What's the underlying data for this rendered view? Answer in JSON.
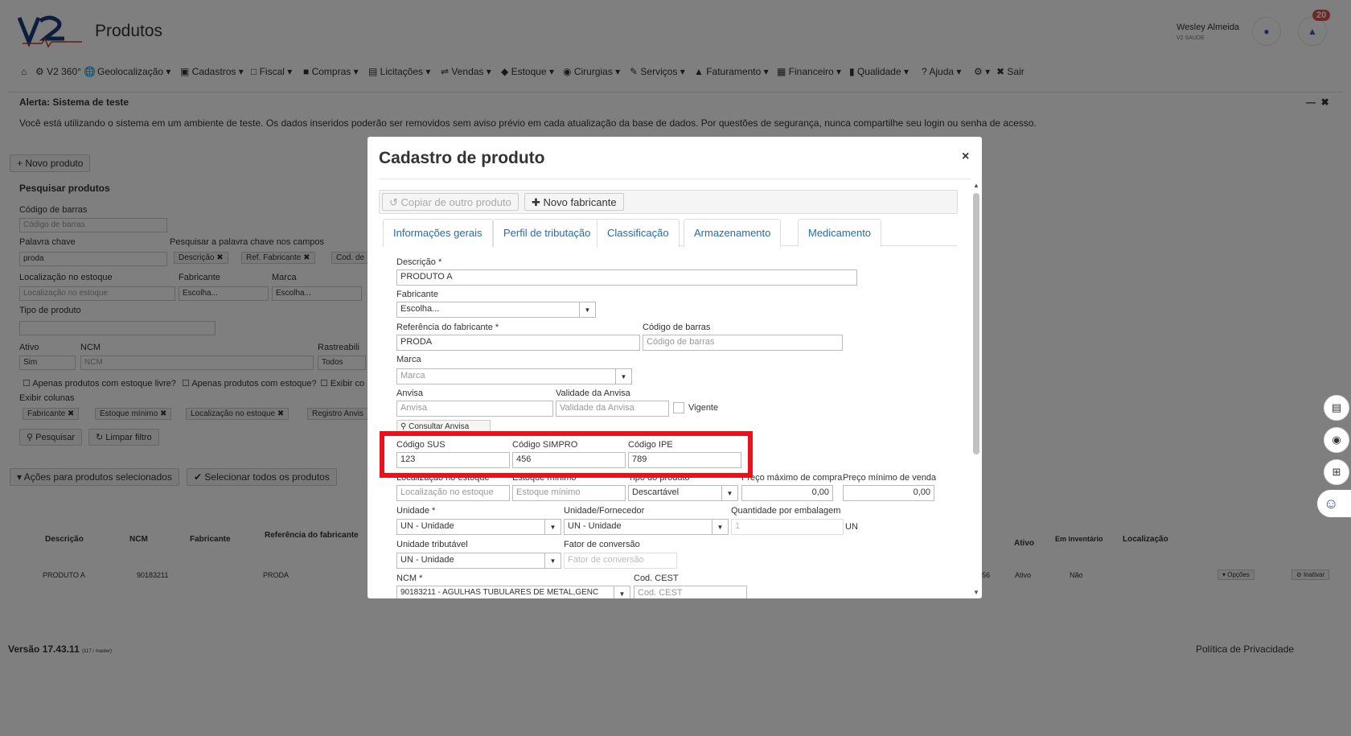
{
  "header": {
    "logo_text": "V2 Saúde",
    "page_title": "Produtos",
    "user_name": "Wesley Almeida",
    "user_org": "V2 SAUDE",
    "notification_count": "20"
  },
  "menu": [
    "V2 360°",
    "Geolocalização",
    "Cadastros",
    "Fiscal",
    "Compras",
    "Licitações",
    "Vendas",
    "Estoque",
    "Cirurgias",
    "Serviços",
    "Faturamento",
    "Financeiro",
    "Qualidade",
    "Ajuda",
    "Sair"
  ],
  "alert": {
    "title": "Alerta: Sistema de teste",
    "text": "Você está utilizando o sistema em um ambiente de teste. Os dados inseridos poderão ser removidos sem aviso prévio em cada atualização da base de dados. Por questões de segurança, nunca compartilhe seu login ou senha de acesso."
  },
  "bg_page": {
    "new_product_button": "Novo produto",
    "search_title": "Pesquisar produtos",
    "barcode_label": "Código de barras",
    "barcode_placeholder": "Código de barras",
    "keyword_label": "Palavra chave",
    "keyword_value": "proda",
    "keyword_fields_label": "Pesquisar a palavra chave nos campos",
    "keyword_chips": [
      "Descrição",
      "Ref. Fabricante",
      "Cod. de"
    ],
    "stock_location_label": "Localização no estoque",
    "stock_location_placeholder": "Localização no estoque",
    "manufacturer_label": "Fabricante",
    "manufacturer_value": "Escolha...",
    "brand_label": "Marca",
    "brand_value": "Escolha...",
    "product_type_label": "Tipo de produto",
    "active_label": "Ativo",
    "active_value": "Sim",
    "ncm_label": "NCM",
    "ncm_placeholder": "NCM",
    "trace_label": "Rastreabili",
    "trace_value": "Todos",
    "check_free_stock": "Apenas produtos com estoque livre?",
    "check_stock": "Apenas produtos com estoque?",
    "check_show": "Exibir co",
    "show_columns_label": "Exibir colunas",
    "column_chips": [
      "Fabricante",
      "Estoque mínimo",
      "Localização no estoque",
      "Registro Anvis"
    ],
    "search_button": "Pesquisar",
    "clear_button": "Limpar filtro",
    "actions_button": "Ações para produtos selecionados",
    "select_all_button": "Selecionar todos os produtos",
    "table_headers": [
      "Descrição",
      "NCM",
      "Fabricante",
      "Referência do fabricante",
      "Ativo",
      "Em inventário",
      "Localização"
    ],
    "row": {
      "descricao": "PRODUTO A",
      "ncm": "90183211",
      "referencia": "PRODA",
      "num": "56",
      "ativo": "Ativo",
      "inventario": "Não",
      "opcoes": "Opções",
      "inativar": "Inativar"
    },
    "footer_version": "Versão 17.43.11",
    "footer_version_sub": "(117 / master)",
    "footer_privacy": "Política de Privacidade"
  },
  "modal": {
    "title": "Cadastro de produto",
    "close": "×",
    "copy_button": "Copiar de outro produto",
    "new_manufacturer_button": "Novo fabricante",
    "tabs": [
      "Informações gerais",
      "Perfil de tributação",
      "Classificação",
      "Armazenamento",
      "Medicamento"
    ],
    "fields": {
      "descricao_label": "Descrição *",
      "descricao_value": "PRODUTO A",
      "fabricante_label": "Fabricante",
      "fabricante_value": "Escolha...",
      "ref_fabricante_label": "Referência do fabricante *",
      "ref_fabricante_value": "PRODA",
      "cod_barras_label": "Código de barras",
      "cod_barras_placeholder": "Código de barras",
      "marca_label": "Marca",
      "marca_value": "Marca",
      "anvisa_label": "Anvisa",
      "anvisa_placeholder": "Anvisa",
      "validade_anvisa_label": "Validade da Anvisa",
      "validade_anvisa_placeholder": "Validade da Anvisa",
      "vigente_label": "Vigente",
      "consultar_anvisa_button": "Consultar Anvisa",
      "cod_sus_label": "Código SUS",
      "cod_sus_value": "123",
      "cod_simpro_label": "Código SIMPRO",
      "cod_simpro_value": "456",
      "cod_ipe_label": "Código IPE",
      "cod_ipe_value": "789",
      "loc_estoque_label": "Localização no estoque",
      "loc_estoque_placeholder": "Localização no estoque",
      "estoque_min_label": "Estoque mínimo",
      "estoque_min_placeholder": "Estoque mínimo",
      "tipo_produto_label": "Tipo do produto",
      "tipo_produto_value": "Descartável",
      "preco_max_label": "Preço máximo de compra",
      "preco_max_value": "0,00",
      "preco_min_label": "Preço mínimo de venda",
      "preco_min_value": "0,00",
      "unidade_label": "Unidade *",
      "unidade_value": "UN - Unidade",
      "unidade_forn_label": "Unidade/Fornecedor",
      "unidade_forn_value": "UN - Unidade",
      "qtd_emb_label": "Quantidade por embalagem",
      "qtd_emb_value": "1",
      "qtd_emb_unit": "UN",
      "unid_trib_label": "Unidade tributável",
      "unid_trib_value": "UN - Unidade",
      "fator_conv_label": "Fator de conversão",
      "fator_conv_placeholder": "Fator de conversão",
      "ncm_label": "NCM *",
      "ncm_value": "90183211 - AGULHAS TUBULARES DE METAL,GENC",
      "cest_label": "Cod. CEST",
      "cest_placeholder": "Cod. CEST"
    }
  },
  "colors": {
    "highlight": "#e8121c",
    "link": "#1f6db5",
    "badge": "#d9534f"
  }
}
